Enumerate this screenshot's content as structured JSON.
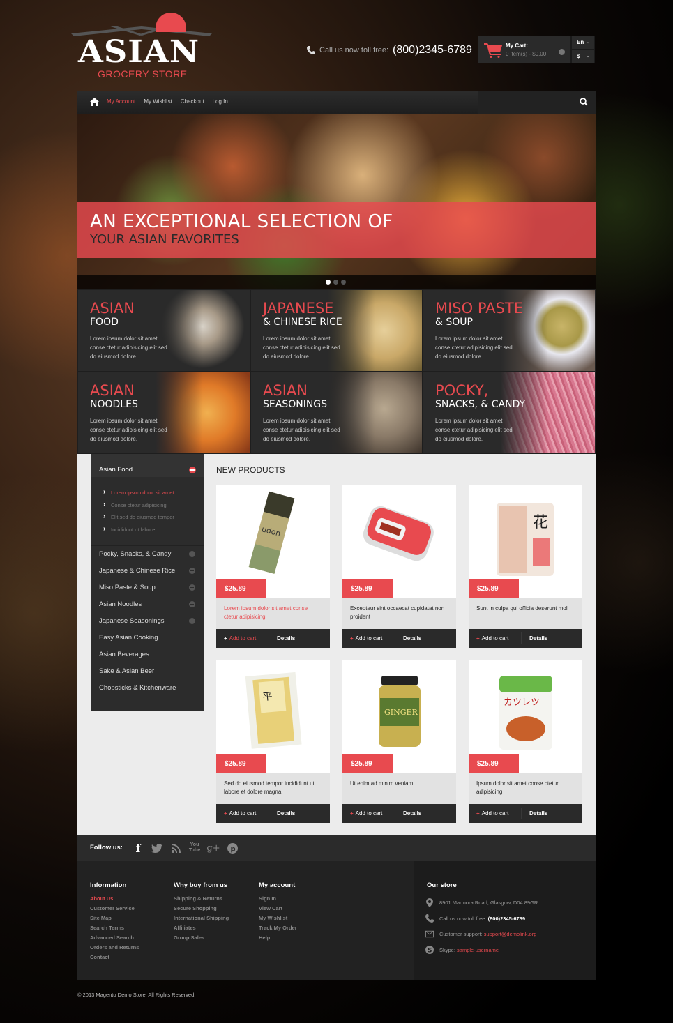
{
  "header": {
    "logo_name": "ASIAN",
    "logo_sub": "GROCERY STORE",
    "phone_label": "Call us now toll free:",
    "phone_number": "(800)2345-6789",
    "cart_title": "My Cart:",
    "cart_summary": "0 item(s) - $0.00",
    "language": "En",
    "currency": "$"
  },
  "nav": {
    "items": [
      {
        "label": "My Account",
        "active": true
      },
      {
        "label": "My Wishlist",
        "active": false
      },
      {
        "label": "Checkout",
        "active": false
      },
      {
        "label": "Log In",
        "active": false
      }
    ]
  },
  "slider": {
    "headline": "AN EXCEPTIONAL SELECTION OF",
    "subheadline": "YOUR ASIAN FAVORITES",
    "slide_count": 3,
    "active_slide": 1
  },
  "categories": [
    {
      "title": "ASIAN",
      "subtitle": "FOOD",
      "desc": "Lorem ipsum dolor sit amet conse ctetur adipisicing elit sed do eiusmod dolore."
    },
    {
      "title": "JAPANESE",
      "subtitle": "& CHINESE RICE",
      "desc": "Lorem ipsum dolor sit amet conse ctetur adipisicing elit sed do eiusmod dolore."
    },
    {
      "title": "MISO PASTE",
      "subtitle": "& SOUP",
      "desc": "Lorem ipsum dolor sit amet conse ctetur adipisicing elit sed do eiusmod dolore."
    },
    {
      "title": "ASIAN",
      "subtitle": "NOODLES",
      "desc": "Lorem ipsum dolor sit amet conse ctetur adipisicing elit sed do eiusmod dolore."
    },
    {
      "title": "ASIAN",
      "subtitle": "SEASONINGS",
      "desc": "Lorem ipsum dolor sit amet conse ctetur adipisicing elit sed do eiusmod dolore."
    },
    {
      "title": "POCKY,",
      "subtitle": "SNACKS, & CANDY",
      "desc": "Lorem ipsum dolor sit amet conse ctetur adipisicing elit sed do eiusmod dolore."
    }
  ],
  "sidebar": {
    "open_category": "Asian Food",
    "subitems": [
      {
        "label": "Lorem ipsum dolor sit amet",
        "active": true
      },
      {
        "label": "Conse ctetur adipisicing",
        "active": false
      },
      {
        "label": "Elit sed do eiusmod tempor",
        "active": false
      },
      {
        "label": "Incididunt ut labore",
        "active": false
      }
    ],
    "items": [
      {
        "label": "Pocky, Snacks, & Candy",
        "expandable": true
      },
      {
        "label": "Japanese & Chinese Rice",
        "expandable": true
      },
      {
        "label": "Miso Paste & Soup",
        "expandable": true
      },
      {
        "label": "Asian Noodles",
        "expandable": true
      },
      {
        "label": "Japanese Seasonings",
        "expandable": true
      },
      {
        "label": "Easy Asian Cooking",
        "expandable": false
      },
      {
        "label": "Asian Beverages",
        "expandable": false
      },
      {
        "label": "Sake & Asian Beer",
        "expandable": false
      },
      {
        "label": "Chopsticks & Kitchenware",
        "expandable": false
      }
    ]
  },
  "products": {
    "title": "NEW PRODUCTS",
    "add_label": "Add to cart",
    "details_label": "Details",
    "items": [
      {
        "price": "$25.89",
        "name": "Lorem ipsum dolor sit amet conse ctetur adipisicing",
        "image": "udon-noodles",
        "highlight": true
      },
      {
        "price": "$25.89",
        "name": "Excepteur sint occaecat cupidatat non proident",
        "image": "canned-fish",
        "highlight": false
      },
      {
        "price": "$25.89",
        "name": "Sunt in culpa qui officia deserunt moll",
        "image": "bonito-flakes",
        "highlight": false
      },
      {
        "price": "$25.89",
        "name": "Sed do eiusmod tempor incididunt ut labore et dolore magna",
        "image": "soba-noodles",
        "highlight": false
      },
      {
        "price": "$25.89",
        "name": "Ut enim ad minim veniam",
        "image": "ginger-jar",
        "highlight": false
      },
      {
        "price": "$25.89",
        "name": "Ipsum dolor sit amet conse ctetur adipisicing",
        "image": "katsu-sauce",
        "highlight": false
      }
    ]
  },
  "follow": {
    "label": "Follow us:",
    "icons": [
      "facebook-icon",
      "twitter-icon",
      "rss-icon",
      "youtube-icon",
      "google-plus-icon",
      "pinterest-icon"
    ]
  },
  "footer": {
    "columns": [
      {
        "title": "Information",
        "links": [
          {
            "label": "About Us",
            "active": true
          },
          {
            "label": "Customer Service",
            "active": false
          },
          {
            "label": "Site Map",
            "active": false
          },
          {
            "label": "Search Terms",
            "active": false
          },
          {
            "label": "Advanced Search",
            "active": false
          },
          {
            "label": "Orders and Returns",
            "active": false
          },
          {
            "label": "Contact",
            "active": false
          }
        ]
      },
      {
        "title": "Why buy from us",
        "links": [
          {
            "label": "Shipping & Returns",
            "active": false
          },
          {
            "label": "Secure Shopping",
            "active": false
          },
          {
            "label": "International Shipping",
            "active": false
          },
          {
            "label": "Affiliates",
            "active": false
          },
          {
            "label": "Group Sales",
            "active": false
          }
        ]
      },
      {
        "title": "My account",
        "links": [
          {
            "label": "Sign In",
            "active": false
          },
          {
            "label": "View Cart",
            "active": false
          },
          {
            "label": "My Wishlist",
            "active": false
          },
          {
            "label": "Track My Order",
            "active": false
          },
          {
            "label": "Help",
            "active": false
          }
        ]
      }
    ],
    "store": {
      "title": "Our store",
      "address": "8901 Marmora Road, Glasgow, D04 89GR",
      "phone_label": "Call us now toll free:",
      "phone": "(800)2345-6789",
      "support_label": "Customer support:",
      "support_email": "support@demolink.org",
      "skype_label": "Skype:",
      "skype_user": "sample-username"
    },
    "copyright": "© 2013 Magento Demo Store. All Rights Reserved."
  },
  "colors": {
    "accent": "#e84a4f",
    "dark": "#2a2a2a"
  }
}
